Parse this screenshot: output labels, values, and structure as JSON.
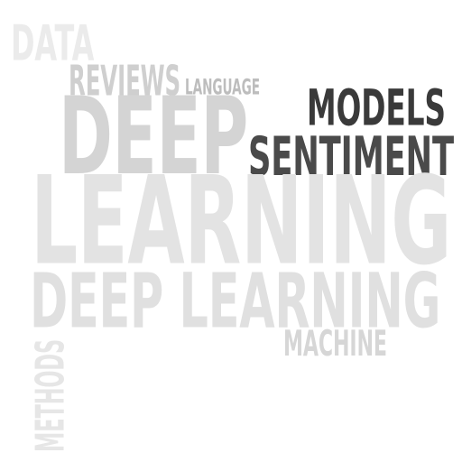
{
  "word_cloud": {
    "words": [
      {
        "id": "data",
        "text": "DATA",
        "color": "#ebebeb"
      },
      {
        "id": "reviews",
        "text": "REVIEWS",
        "color": "#cfcfcf"
      },
      {
        "id": "language",
        "text": "LANGUAGE",
        "color": "#bdbdbd"
      },
      {
        "id": "models",
        "text": "MODELS",
        "color": "#3a3a3a"
      },
      {
        "id": "deep",
        "text": "DEEP",
        "color": "#d4d4d4"
      },
      {
        "id": "sentiment",
        "text": "SENTIMENT",
        "color": "#4a4a4a"
      },
      {
        "id": "learning",
        "text": "LEARNING",
        "color": "#e3e3e3"
      },
      {
        "id": "deep-learning",
        "text": "DEEP LEARNING",
        "color": "#e0e0e0"
      },
      {
        "id": "machine",
        "text": "MACHINE",
        "color": "#d6d6d6"
      },
      {
        "id": "methods",
        "text": "METHODS",
        "color": "#e6e6e6"
      }
    ]
  }
}
